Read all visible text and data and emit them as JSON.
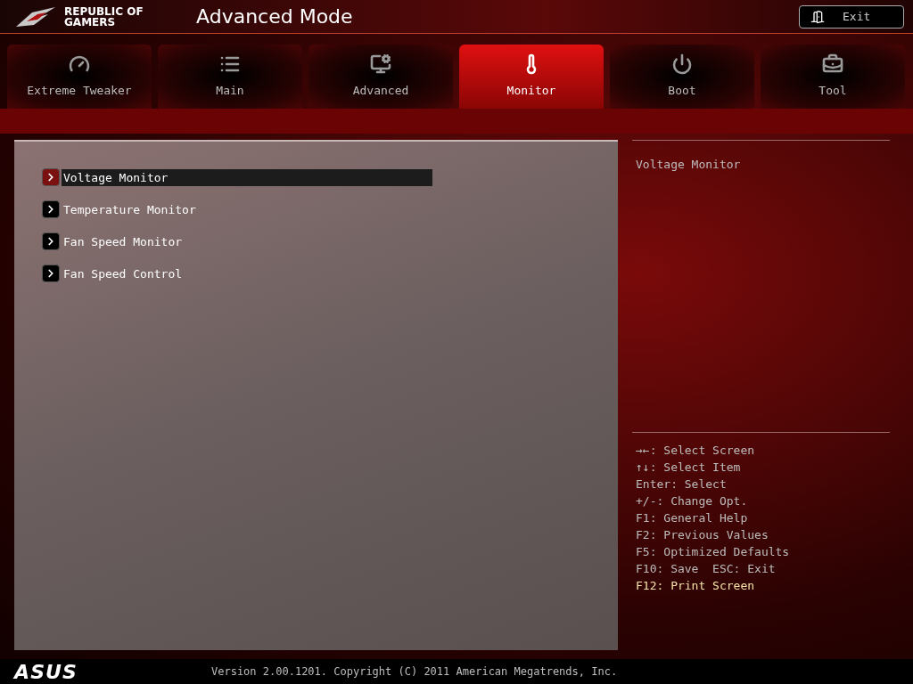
{
  "header": {
    "logo_text": [
      "REPUBLIC OF",
      "GAMERS"
    ],
    "title": "Advanced Mode",
    "exit_button": "Exit"
  },
  "tabs": [
    {
      "label": "Extreme Tweaker",
      "selected": false
    },
    {
      "label": "Main",
      "selected": false
    },
    {
      "label": "Advanced",
      "selected": false
    },
    {
      "label": "Monitor",
      "selected": true
    },
    {
      "label": "Boot",
      "selected": false
    },
    {
      "label": "Tool",
      "selected": false
    }
  ],
  "menu_items": [
    {
      "label": "Voltage Monitor",
      "selected": true
    },
    {
      "label": "Temperature Monitor",
      "selected": false
    },
    {
      "label": "Fan Speed Monitor",
      "selected": false
    },
    {
      "label": "Fan Speed Control",
      "selected": false
    }
  ],
  "help_text": "Voltage Monitor",
  "key_help": [
    {
      "text": "→←: Select Screen",
      "highlighted": false
    },
    {
      "text": "↑↓: Select Item",
      "highlighted": false
    },
    {
      "text": "Enter: Select",
      "highlighted": false
    },
    {
      "text": "+/-: Change Opt.",
      "highlighted": false
    },
    {
      "text": "F1: General Help",
      "highlighted": false
    },
    {
      "text": "F2: Previous Values",
      "highlighted": false
    },
    {
      "text": "F5: Optimized Defaults",
      "highlighted": false
    },
    {
      "text": "F10: Save  ESC: Exit",
      "highlighted": false
    },
    {
      "text": "F12: Print Screen",
      "highlighted": true
    }
  ],
  "footer": {
    "brand": "ASUS",
    "version": "Version 2.00.1201. Copyright (C) 2011 American Megatrends, Inc."
  }
}
